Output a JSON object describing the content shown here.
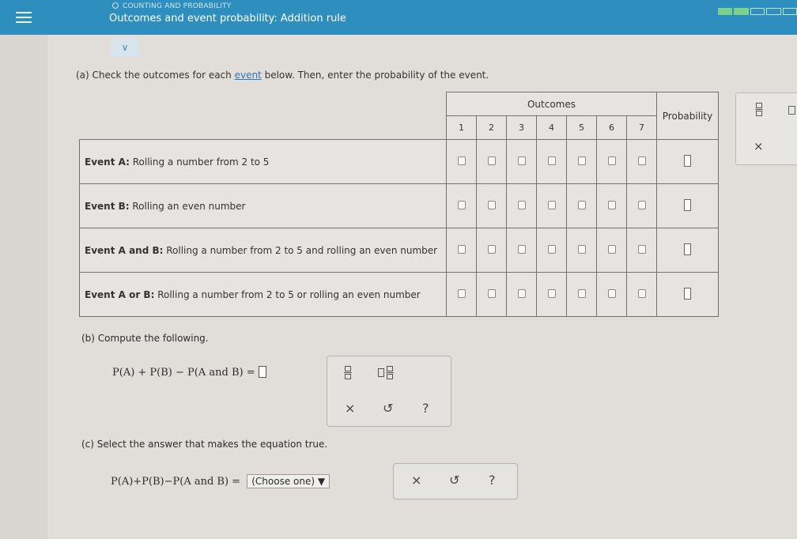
{
  "header": {
    "category": "COUNTING AND PROBABILITY",
    "title": "Outcomes and event probability: Addition rule",
    "progress_filled": 0.4
  },
  "part_a": {
    "prefix": "(a) Check the outcomes for each ",
    "link": "event",
    "suffix": " below. Then, enter the probability of the event."
  },
  "table": {
    "outcomes_label": "Outcomes",
    "probability_label": "Probability",
    "outcomes": [
      "1",
      "2",
      "3",
      "4",
      "5",
      "6",
      "7"
    ],
    "events": [
      {
        "bold": "Event A:",
        "text": " Rolling a number from 2 to 5"
      },
      {
        "bold": "Event B:",
        "text": " Rolling an even number"
      },
      {
        "bold": "Event A and B:",
        "text": " Rolling a number from 2 to 5 and rolling an even number"
      },
      {
        "bold": "Event A or B:",
        "text": " Rolling a number from 2 to 5 or rolling an even number"
      }
    ]
  },
  "palette": {
    "close": "×"
  },
  "part_b": {
    "label": "(b) Compute the following.",
    "equation": "P(A) + P(B) − P(A and B) ="
  },
  "tools": {
    "clear": "×",
    "undo": "↺",
    "help": "?"
  },
  "part_c": {
    "label": "(c) Select the answer that makes the equation true.",
    "equation": "P(A)+P(B)−P(A and B) =",
    "dropdown": "(Choose one) ▼"
  }
}
